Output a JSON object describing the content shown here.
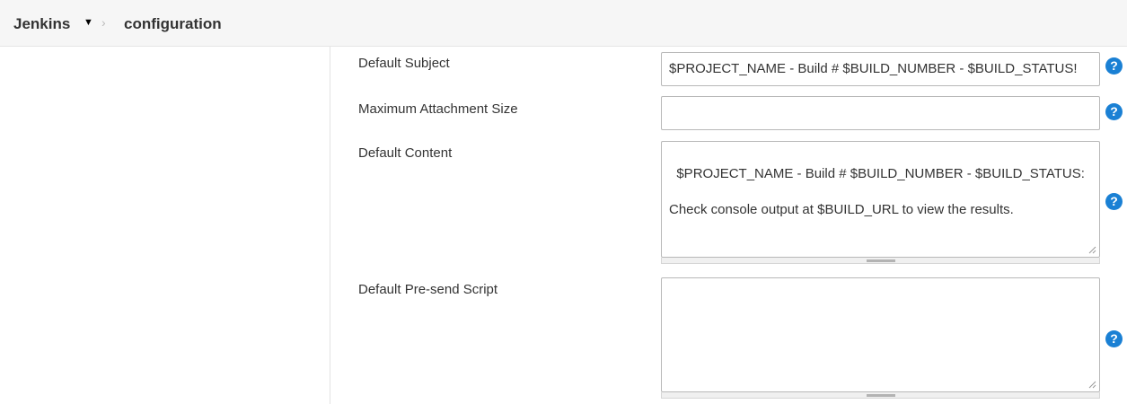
{
  "breadcrumb": {
    "home": "Jenkins",
    "caret_icon": "caret-down-icon",
    "separator_icon": "chevron-right-icon",
    "separator": "›",
    "current": "configuration"
  },
  "fields": {
    "default_subject": {
      "label": "Default Subject",
      "value": "$PROJECT_NAME - Build # $BUILD_NUMBER - $BUILD_STATUS!"
    },
    "max_attachment_size": {
      "label": "Maximum Attachment Size",
      "value": ""
    },
    "default_content": {
      "label": "Default Content",
      "value": "$PROJECT_NAME - Build # $BUILD_NUMBER - $BUILD_STATUS:\n\nCheck console output at $BUILD_URL to view the results."
    },
    "default_presend_script": {
      "label": "Default Pre-send Script",
      "value": ""
    }
  },
  "help": {
    "icon": "help-icon",
    "glyph": "?",
    "color": "#1a80d4"
  }
}
